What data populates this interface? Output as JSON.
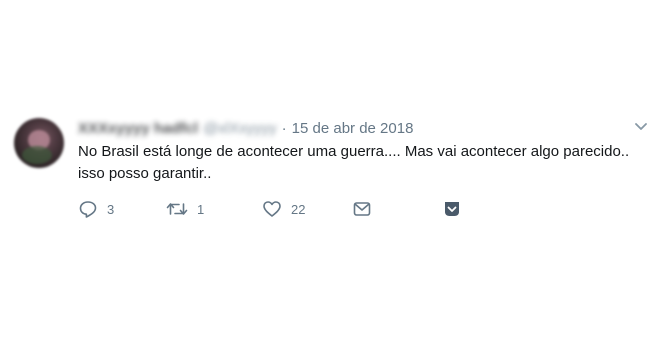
{
  "tweet": {
    "author_name": "XXXxyyyy hadfcl",
    "author_handle": "@xlXxyyyy",
    "separator": "·",
    "date": "15 de abr de 2018",
    "text": "No Brasil está longe de acontecer uma guerra.... Mas vai acontecer algo parecido.. isso posso garantir..",
    "actions": {
      "reply_count": "3",
      "retweet_count": "1",
      "like_count": "22"
    },
    "icons": {
      "menu": "chevron-down-icon",
      "reply": "reply-icon",
      "retweet": "retweet-icon",
      "like": "heart-icon",
      "dm": "envelope-icon",
      "analytics": "analytics-icon"
    },
    "colors": {
      "text": "#14171a",
      "secondary": "#657786"
    }
  }
}
